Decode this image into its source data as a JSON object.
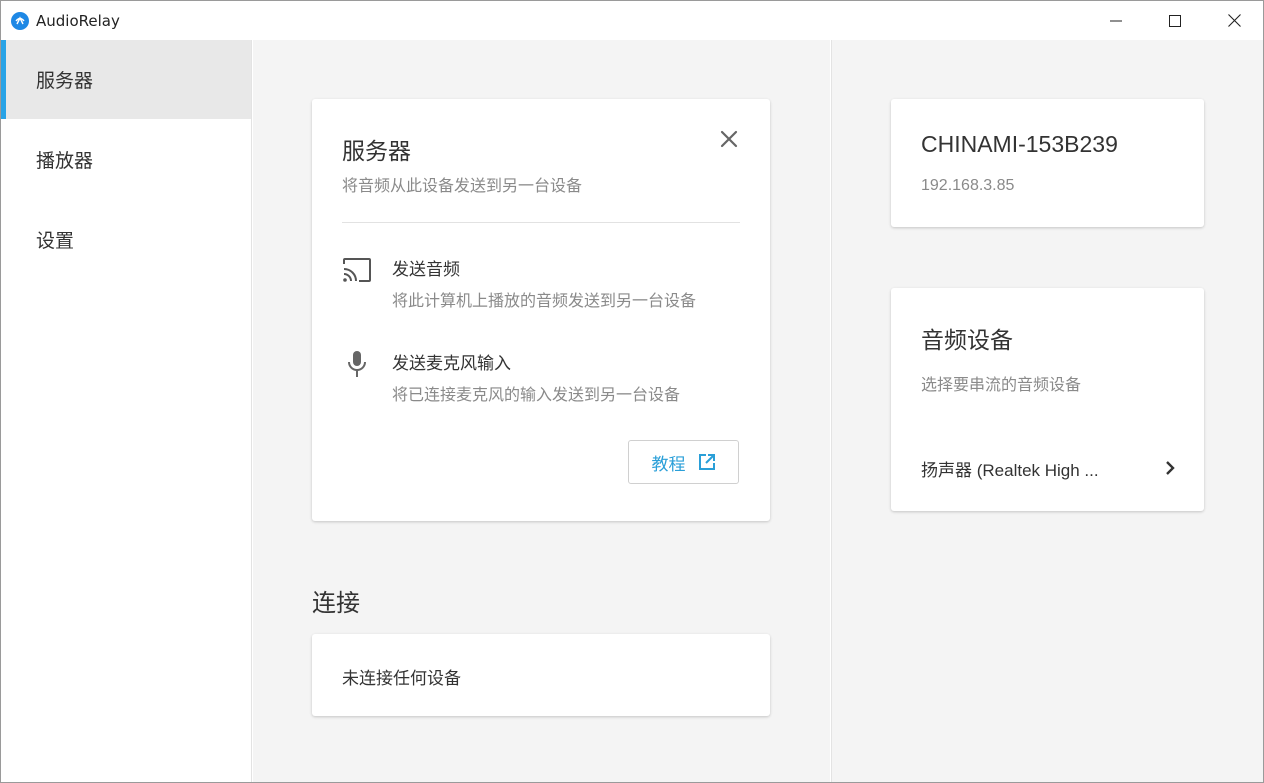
{
  "window": {
    "title": "AudioRelay",
    "accent": "#29a3e6",
    "controls": [
      "minimize-icon",
      "maximize-icon",
      "close-icon"
    ]
  },
  "sidebar": {
    "items": [
      {
        "label": "服务器",
        "active": true
      },
      {
        "label": "播放器",
        "active": false
      },
      {
        "label": "设置",
        "active": false
      }
    ]
  },
  "server_card": {
    "title": "服务器",
    "subtitle": "将音频从此设备发送到另一台设备",
    "features": [
      {
        "icon": "cast-icon",
        "title": "发送音频",
        "description": "将此计算机上播放的音频发送到另一台设备"
      },
      {
        "icon": "microphone-icon",
        "title": "发送麦克风输入",
        "description": "将已连接麦克风的输入发送到另一台设备"
      }
    ],
    "tutorial_label": "教程"
  },
  "connections": {
    "title": "连接",
    "empty_text": "未连接任何设备"
  },
  "host": {
    "name": "CHINAMI-153B239",
    "ip": "192.168.3.85"
  },
  "audio_device": {
    "title": "音频设备",
    "subtitle": "选择要串流的音频设备",
    "selected": "扬声器 (Realtek High ..."
  }
}
